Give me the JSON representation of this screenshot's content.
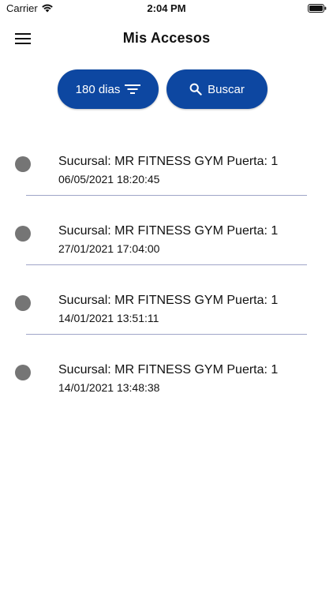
{
  "status_bar": {
    "carrier": "Carrier",
    "time": "2:04 PM"
  },
  "header": {
    "title": "Mis Accesos",
    "menu_icon": "hamburger-menu-icon"
  },
  "filters": {
    "days_label": "180 dias",
    "days_icon": "filter-list-icon",
    "search_label": "Buscar",
    "search_icon": "search-icon"
  },
  "colors": {
    "primary": "#0d47a1",
    "dot": "#757575",
    "divider": "#9fa5c8"
  },
  "accesses": [
    {
      "title": "Sucursal: MR FITNESS GYM Puerta: 1",
      "date": "06/05/2021 18:20:45"
    },
    {
      "title": "Sucursal: MR FITNESS GYM Puerta: 1",
      "date": "27/01/2021 17:04:00"
    },
    {
      "title": "Sucursal: MR FITNESS GYM Puerta: 1",
      "date": "14/01/2021 13:51:11"
    },
    {
      "title": "Sucursal: MR FITNESS GYM Puerta: 1",
      "date": "14/01/2021 13:48:38"
    }
  ]
}
